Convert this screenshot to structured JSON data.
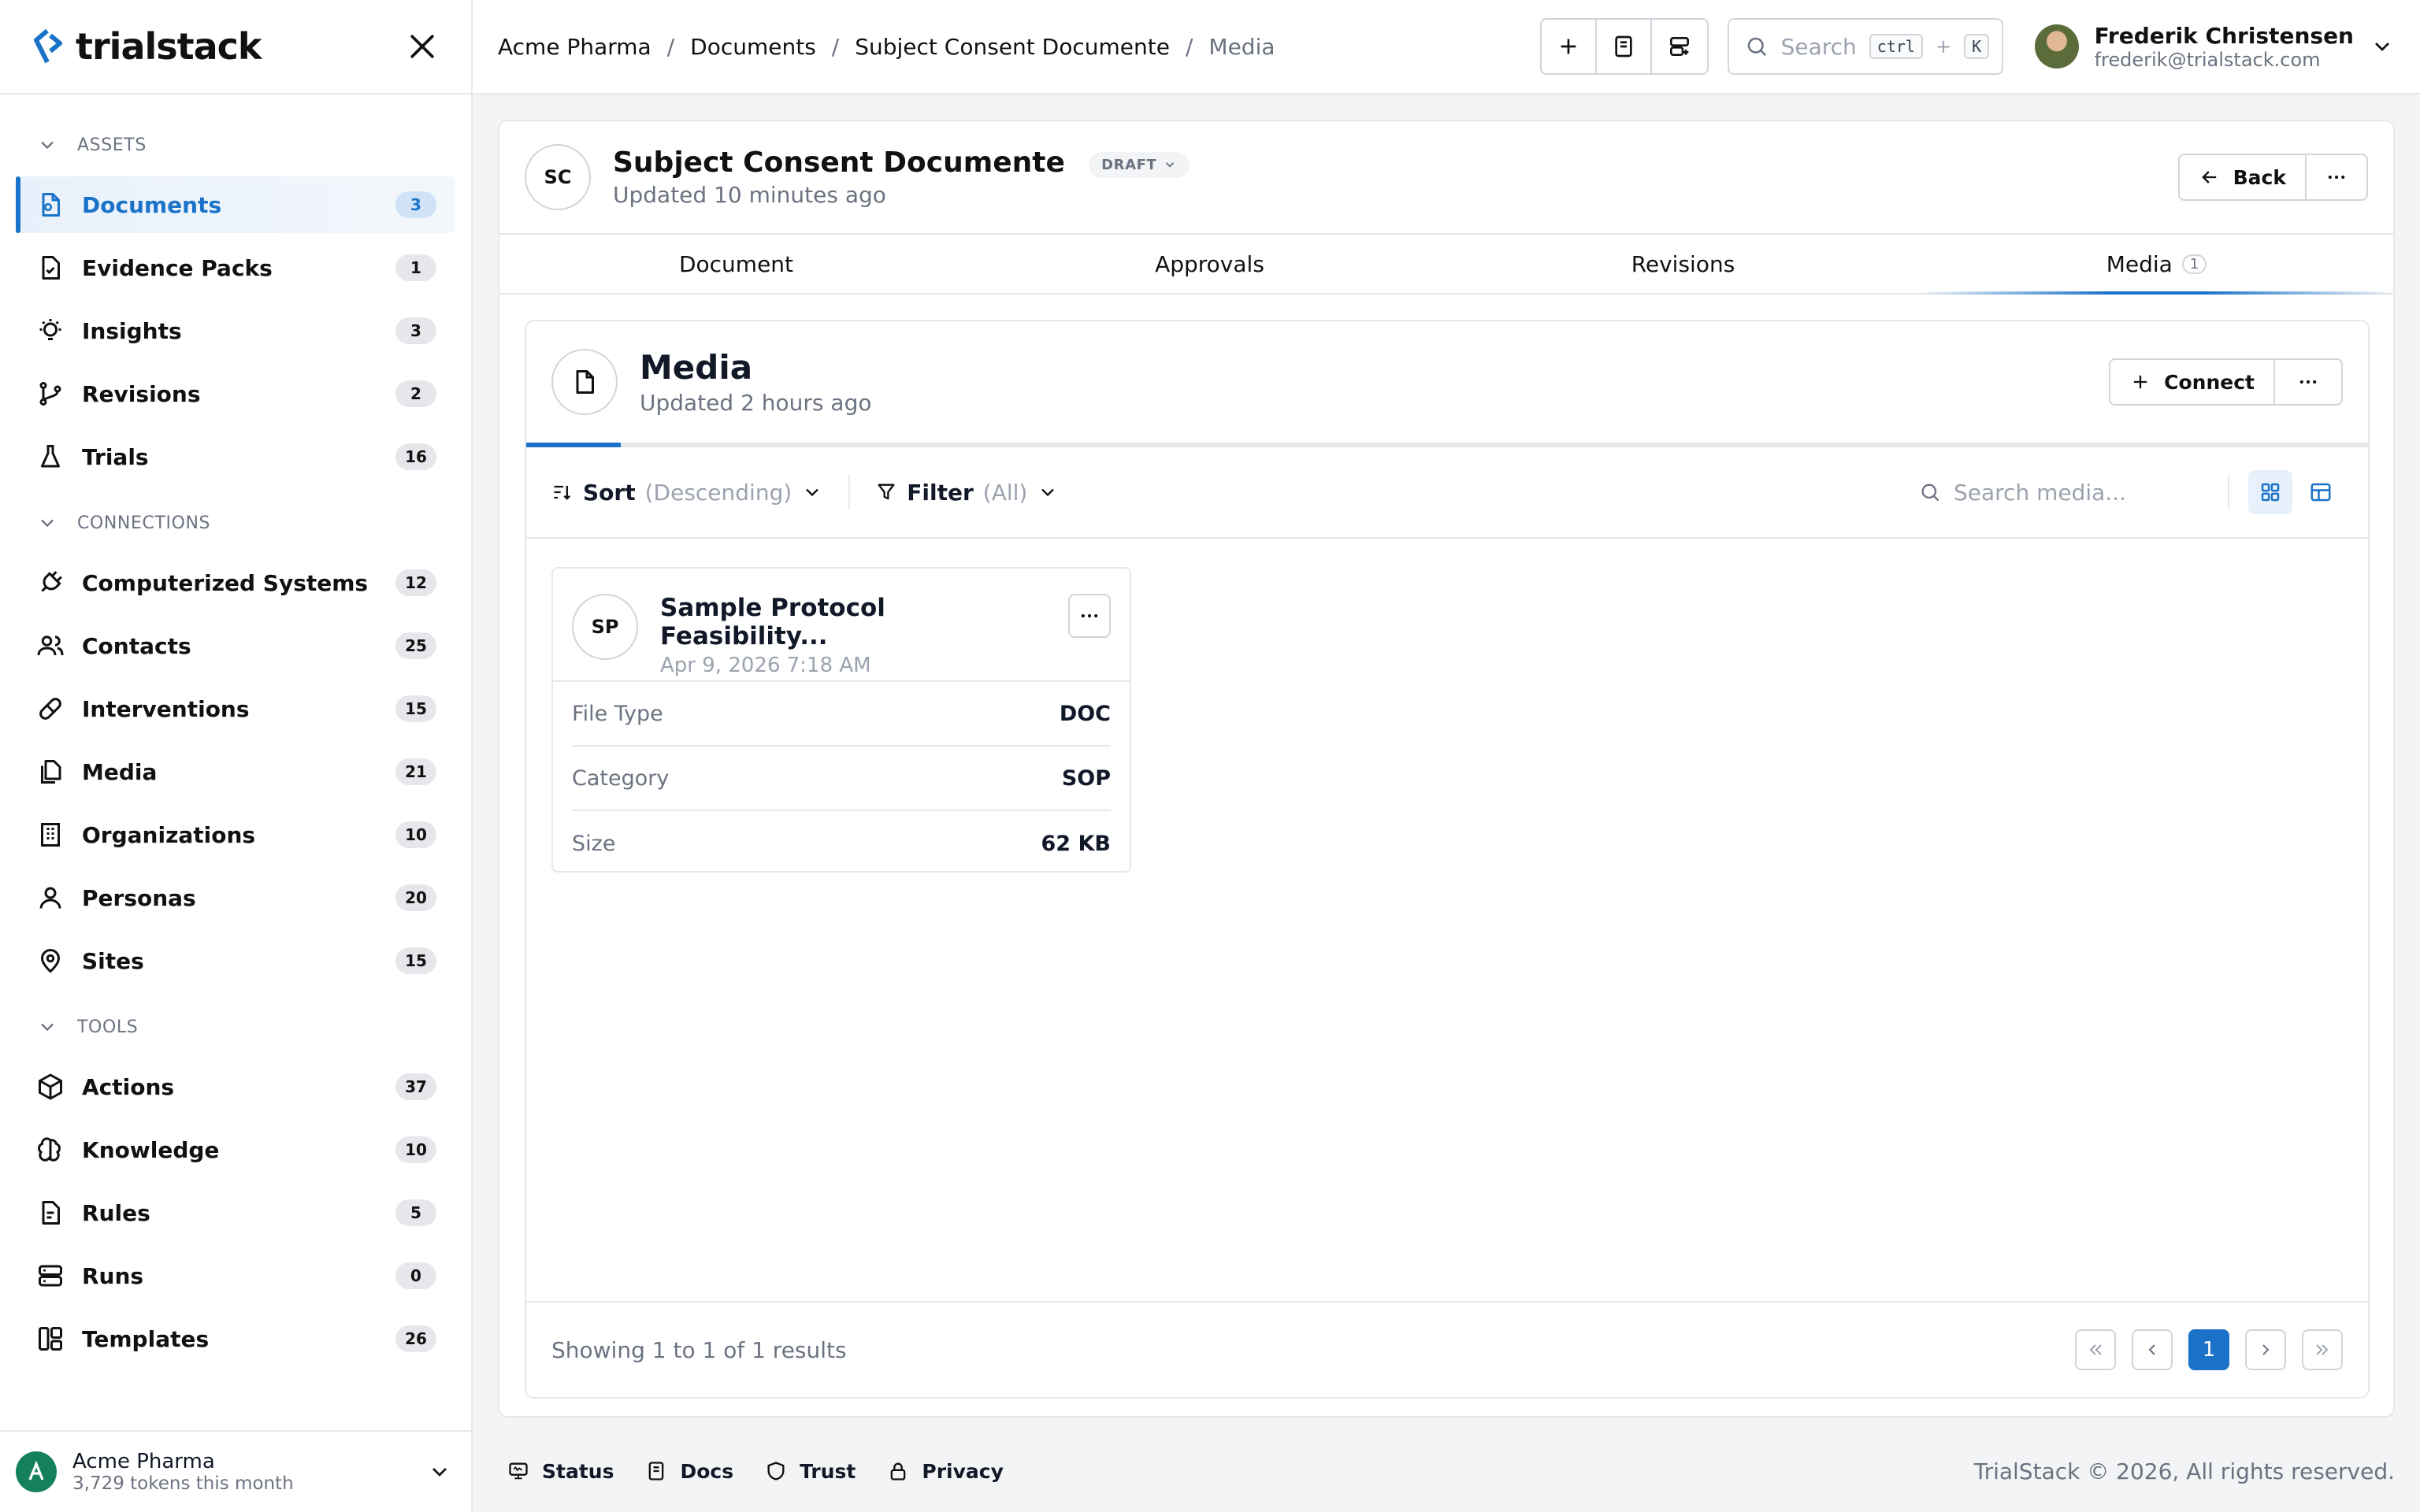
{
  "brand": {
    "name": "trialstack"
  },
  "sidebar": {
    "sections": [
      {
        "label": "ASSETS",
        "items": [
          {
            "label": "Documents",
            "count": "3",
            "icon": "document-icon",
            "active": true
          },
          {
            "label": "Evidence Packs",
            "count": "1",
            "icon": "evidence-pack-icon"
          },
          {
            "label": "Insights",
            "count": "3",
            "icon": "lightbulb-icon"
          },
          {
            "label": "Revisions",
            "count": "2",
            "icon": "git-branch-icon"
          },
          {
            "label": "Trials",
            "count": "16",
            "icon": "flask-icon"
          }
        ]
      },
      {
        "label": "CONNECTIONS",
        "items": [
          {
            "label": "Computerized Systems",
            "count": "12",
            "icon": "plug-icon"
          },
          {
            "label": "Contacts",
            "count": "25",
            "icon": "users-icon"
          },
          {
            "label": "Interventions",
            "count": "15",
            "icon": "pill-icon"
          },
          {
            "label": "Media",
            "count": "21",
            "icon": "files-icon"
          },
          {
            "label": "Organizations",
            "count": "10",
            "icon": "building-icon"
          },
          {
            "label": "Personas",
            "count": "20",
            "icon": "user-icon"
          },
          {
            "label": "Sites",
            "count": "15",
            "icon": "map-pin-icon"
          }
        ]
      },
      {
        "label": "TOOLS",
        "items": [
          {
            "label": "Actions",
            "count": "37",
            "icon": "box-icon"
          },
          {
            "label": "Knowledge",
            "count": "10",
            "icon": "brain-icon"
          },
          {
            "label": "Rules",
            "count": "5",
            "icon": "file-rules-icon"
          },
          {
            "label": "Runs",
            "count": "0",
            "icon": "server-icon"
          },
          {
            "label": "Templates",
            "count": "26",
            "icon": "layout-icon"
          }
        ]
      }
    ],
    "org": {
      "name": "Acme Pharma",
      "usage": "3,729 tokens this month"
    }
  },
  "topbar": {
    "breadcrumbs": [
      "Acme Pharma",
      "Documents",
      "Subject Consent Documente",
      "Media"
    ],
    "search": {
      "placeholder": "Search",
      "kbd1": "ctrl",
      "plus": "+",
      "kbd2": "K"
    },
    "user": {
      "name": "Frederik Christensen",
      "email": "frederik@trialstack.com"
    }
  },
  "document": {
    "initials": "SC",
    "title": "Subject Consent Documente",
    "status": "DRAFT",
    "updated": "Updated 10 minutes ago",
    "back_label": "Back"
  },
  "tabs": [
    {
      "label": "Document"
    },
    {
      "label": "Approvals"
    },
    {
      "label": "Revisions"
    },
    {
      "label": "Media",
      "count": "1",
      "active": true
    }
  ],
  "media": {
    "title": "Media",
    "updated": "Updated 2 hours ago",
    "connect_label": "Connect",
    "sort_label": "Sort",
    "sort_value": "(Descending)",
    "filter_label": "Filter",
    "filter_value": "(All)",
    "search_placeholder": "Search media...",
    "cards": [
      {
        "initials": "SP",
        "title": "Sample Protocol Feasibility...",
        "date": "Apr 9, 2026 7:18 AM",
        "fields": [
          {
            "k": "File Type",
            "v": "DOC"
          },
          {
            "k": "Category",
            "v": "SOP"
          },
          {
            "k": "Size",
            "v": "62 KB"
          }
        ]
      }
    ],
    "results": "Showing 1 to 1 of 1 results",
    "current_page": "1"
  },
  "footer": {
    "links": [
      "Status",
      "Docs",
      "Trust",
      "Privacy"
    ],
    "copyright": "TrialStack © 2026, All rights reserved."
  },
  "colors": {
    "accent": "#1a73c8",
    "border": "#e5e7eb"
  }
}
